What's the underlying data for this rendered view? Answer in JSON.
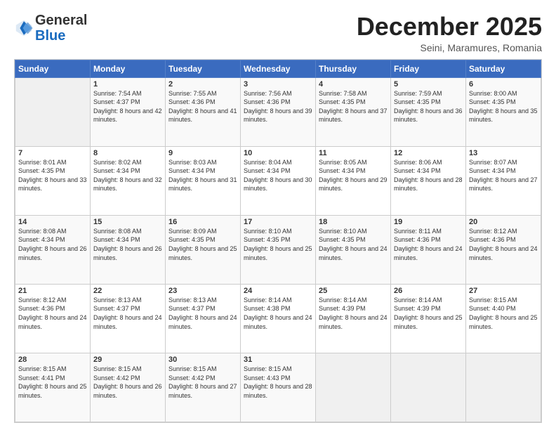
{
  "header": {
    "logo_general": "General",
    "logo_blue": "Blue",
    "month_title": "December 2025",
    "subtitle": "Seini, Maramures, Romania"
  },
  "weekdays": [
    "Sunday",
    "Monday",
    "Tuesday",
    "Wednesday",
    "Thursday",
    "Friday",
    "Saturday"
  ],
  "weeks": [
    [
      {
        "day": "",
        "sunrise": "",
        "sunset": "",
        "daylight": ""
      },
      {
        "day": "1",
        "sunrise": "Sunrise: 7:54 AM",
        "sunset": "Sunset: 4:37 PM",
        "daylight": "Daylight: 8 hours and 42 minutes."
      },
      {
        "day": "2",
        "sunrise": "Sunrise: 7:55 AM",
        "sunset": "Sunset: 4:36 PM",
        "daylight": "Daylight: 8 hours and 41 minutes."
      },
      {
        "day": "3",
        "sunrise": "Sunrise: 7:56 AM",
        "sunset": "Sunset: 4:36 PM",
        "daylight": "Daylight: 8 hours and 39 minutes."
      },
      {
        "day": "4",
        "sunrise": "Sunrise: 7:58 AM",
        "sunset": "Sunset: 4:35 PM",
        "daylight": "Daylight: 8 hours and 37 minutes."
      },
      {
        "day": "5",
        "sunrise": "Sunrise: 7:59 AM",
        "sunset": "Sunset: 4:35 PM",
        "daylight": "Daylight: 8 hours and 36 minutes."
      },
      {
        "day": "6",
        "sunrise": "Sunrise: 8:00 AM",
        "sunset": "Sunset: 4:35 PM",
        "daylight": "Daylight: 8 hours and 35 minutes."
      }
    ],
    [
      {
        "day": "7",
        "sunrise": "Sunrise: 8:01 AM",
        "sunset": "Sunset: 4:35 PM",
        "daylight": "Daylight: 8 hours and 33 minutes."
      },
      {
        "day": "8",
        "sunrise": "Sunrise: 8:02 AM",
        "sunset": "Sunset: 4:34 PM",
        "daylight": "Daylight: 8 hours and 32 minutes."
      },
      {
        "day": "9",
        "sunrise": "Sunrise: 8:03 AM",
        "sunset": "Sunset: 4:34 PM",
        "daylight": "Daylight: 8 hours and 31 minutes."
      },
      {
        "day": "10",
        "sunrise": "Sunrise: 8:04 AM",
        "sunset": "Sunset: 4:34 PM",
        "daylight": "Daylight: 8 hours and 30 minutes."
      },
      {
        "day": "11",
        "sunrise": "Sunrise: 8:05 AM",
        "sunset": "Sunset: 4:34 PM",
        "daylight": "Daylight: 8 hours and 29 minutes."
      },
      {
        "day": "12",
        "sunrise": "Sunrise: 8:06 AM",
        "sunset": "Sunset: 4:34 PM",
        "daylight": "Daylight: 8 hours and 28 minutes."
      },
      {
        "day": "13",
        "sunrise": "Sunrise: 8:07 AM",
        "sunset": "Sunset: 4:34 PM",
        "daylight": "Daylight: 8 hours and 27 minutes."
      }
    ],
    [
      {
        "day": "14",
        "sunrise": "Sunrise: 8:08 AM",
        "sunset": "Sunset: 4:34 PM",
        "daylight": "Daylight: 8 hours and 26 minutes."
      },
      {
        "day": "15",
        "sunrise": "Sunrise: 8:08 AM",
        "sunset": "Sunset: 4:34 PM",
        "daylight": "Daylight: 8 hours and 26 minutes."
      },
      {
        "day": "16",
        "sunrise": "Sunrise: 8:09 AM",
        "sunset": "Sunset: 4:35 PM",
        "daylight": "Daylight: 8 hours and 25 minutes."
      },
      {
        "day": "17",
        "sunrise": "Sunrise: 8:10 AM",
        "sunset": "Sunset: 4:35 PM",
        "daylight": "Daylight: 8 hours and 25 minutes."
      },
      {
        "day": "18",
        "sunrise": "Sunrise: 8:10 AM",
        "sunset": "Sunset: 4:35 PM",
        "daylight": "Daylight: 8 hours and 24 minutes."
      },
      {
        "day": "19",
        "sunrise": "Sunrise: 8:11 AM",
        "sunset": "Sunset: 4:36 PM",
        "daylight": "Daylight: 8 hours and 24 minutes."
      },
      {
        "day": "20",
        "sunrise": "Sunrise: 8:12 AM",
        "sunset": "Sunset: 4:36 PM",
        "daylight": "Daylight: 8 hours and 24 minutes."
      }
    ],
    [
      {
        "day": "21",
        "sunrise": "Sunrise: 8:12 AM",
        "sunset": "Sunset: 4:36 PM",
        "daylight": "Daylight: 8 hours and 24 minutes."
      },
      {
        "day": "22",
        "sunrise": "Sunrise: 8:13 AM",
        "sunset": "Sunset: 4:37 PM",
        "daylight": "Daylight: 8 hours and 24 minutes."
      },
      {
        "day": "23",
        "sunrise": "Sunrise: 8:13 AM",
        "sunset": "Sunset: 4:37 PM",
        "daylight": "Daylight: 8 hours and 24 minutes."
      },
      {
        "day": "24",
        "sunrise": "Sunrise: 8:14 AM",
        "sunset": "Sunset: 4:38 PM",
        "daylight": "Daylight: 8 hours and 24 minutes."
      },
      {
        "day": "25",
        "sunrise": "Sunrise: 8:14 AM",
        "sunset": "Sunset: 4:39 PM",
        "daylight": "Daylight: 8 hours and 24 minutes."
      },
      {
        "day": "26",
        "sunrise": "Sunrise: 8:14 AM",
        "sunset": "Sunset: 4:39 PM",
        "daylight": "Daylight: 8 hours and 25 minutes."
      },
      {
        "day": "27",
        "sunrise": "Sunrise: 8:15 AM",
        "sunset": "Sunset: 4:40 PM",
        "daylight": "Daylight: 8 hours and 25 minutes."
      }
    ],
    [
      {
        "day": "28",
        "sunrise": "Sunrise: 8:15 AM",
        "sunset": "Sunset: 4:41 PM",
        "daylight": "Daylight: 8 hours and 25 minutes."
      },
      {
        "day": "29",
        "sunrise": "Sunrise: 8:15 AM",
        "sunset": "Sunset: 4:42 PM",
        "daylight": "Daylight: 8 hours and 26 minutes."
      },
      {
        "day": "30",
        "sunrise": "Sunrise: 8:15 AM",
        "sunset": "Sunset: 4:42 PM",
        "daylight": "Daylight: 8 hours and 27 minutes."
      },
      {
        "day": "31",
        "sunrise": "Sunrise: 8:15 AM",
        "sunset": "Sunset: 4:43 PM",
        "daylight": "Daylight: 8 hours and 28 minutes."
      },
      {
        "day": "",
        "sunrise": "",
        "sunset": "",
        "daylight": ""
      },
      {
        "day": "",
        "sunrise": "",
        "sunset": "",
        "daylight": ""
      },
      {
        "day": "",
        "sunrise": "",
        "sunset": "",
        "daylight": ""
      }
    ]
  ]
}
